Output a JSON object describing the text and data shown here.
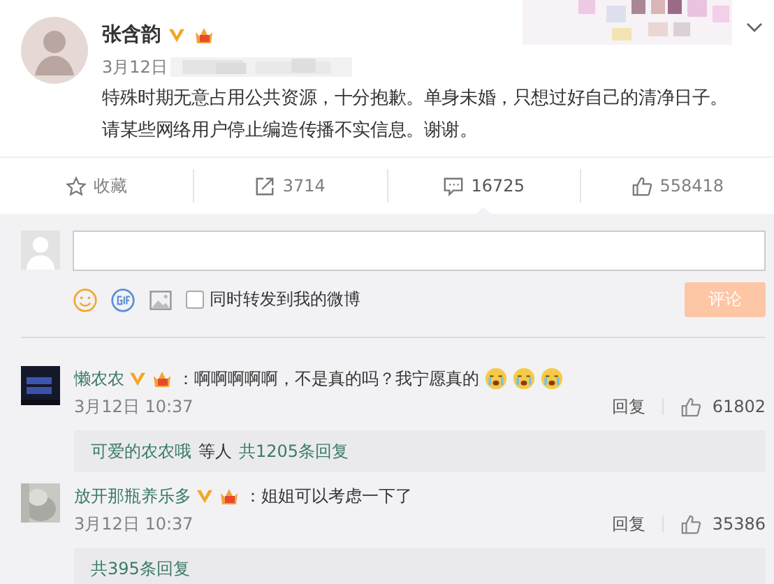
{
  "post": {
    "author": "张含韵",
    "date": "3月12日",
    "lines": [
      "特殊时期无意占用公共资源，十分抱歉。单身未婚，只想过好自己的清净日子。",
      "请某些网络用户停止编造传播不实信息。谢谢。"
    ]
  },
  "actions": [
    {
      "kind": "favorite",
      "label": "收藏",
      "selected": false
    },
    {
      "kind": "repost",
      "label": "3714",
      "selected": false
    },
    {
      "kind": "comment",
      "label": "16725",
      "selected": true
    },
    {
      "kind": "like",
      "label": "558418",
      "selected": false
    }
  ],
  "composer": {
    "share_label": "同时转发到我的微博",
    "share_checked": false,
    "submit": "评论",
    "submit_disabled": true
  },
  "comments": [
    {
      "name": "懒农农",
      "text": "：啊啊啊啊啊，不是真的吗？我宁愿真的",
      "stickers": [
        {
          "kind": "crying"
        },
        {
          "kind": "crying"
        },
        {
          "kind": "crying"
        }
      ],
      "time": "3月12日 10:37",
      "reply": "回复",
      "likes": "61802",
      "replies": {
        "users": "可爱的农农哦",
        "between": "等人",
        "count": "共1205条回复"
      }
    },
    {
      "name": "放开那瓶养乐多",
      "text": "：姐姐可以考虑一下了",
      "time": "3月12日 10:37",
      "reply": "回复",
      "likes": "35386",
      "replies": {
        "count": "共395条回复"
      }
    }
  ]
}
